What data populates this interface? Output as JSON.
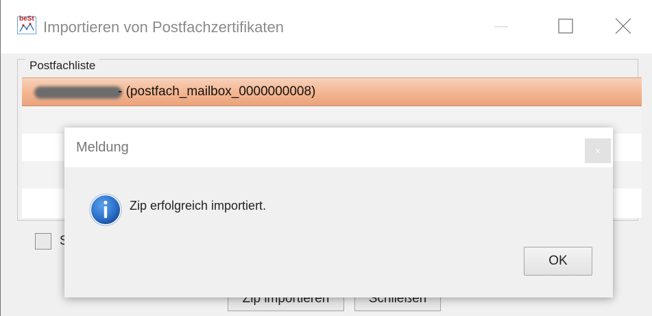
{
  "window": {
    "title": "Importieren von Postfachzertifikaten",
    "app_icon_label": "beSt"
  },
  "group": {
    "legend": "Postfachliste"
  },
  "list": {
    "selected_row_text": "- (postfach_mailbox_0000000008)"
  },
  "buttons": {
    "zip_import": "Zip importieren",
    "close": "Schließen"
  },
  "checkbox": {
    "label_fragment": "S"
  },
  "dialog": {
    "title": "Meldung",
    "close_glyph": "×",
    "message": "Zip erfolgreich importiert.",
    "ok_label": "OK",
    "icon": "info-icon"
  },
  "colors": {
    "selection": "#f4b792",
    "info_icon": "#2a6fc9"
  }
}
